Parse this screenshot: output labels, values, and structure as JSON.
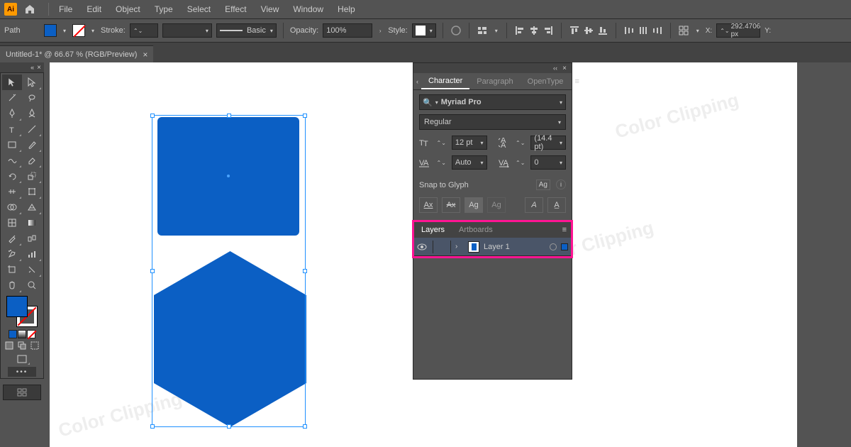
{
  "menu": {
    "items": [
      "File",
      "Edit",
      "Object",
      "Type",
      "Select",
      "Effect",
      "View",
      "Window",
      "Help"
    ]
  },
  "control": {
    "mode_label": "Path",
    "stroke_label": "Stroke:",
    "stroke_weight": "",
    "stroke_profile": "Basic",
    "opacity_label": "Opacity:",
    "opacity_value": "100%",
    "style_label": "Style:",
    "x_label": "X:",
    "x_value": "292.4706 px",
    "y_label": "Y:"
  },
  "tab": {
    "title": "Untitled-1* @ 66.67 % (RGB/Preview)",
    "close": "×"
  },
  "colors": {
    "accent": "#0b5fc4",
    "highlight": "#ff1493"
  },
  "watermark": "Color Clipping",
  "char_panel": {
    "tabs": [
      "Character",
      "Paragraph",
      "OpenType"
    ],
    "font_family": "Myriad Pro",
    "font_style": "Regular",
    "size": "12 pt",
    "leading": "(14.4 pt)",
    "kerning": "Auto",
    "tracking": "0",
    "snap_label": "Snap to Glyph"
  },
  "layers_panel": {
    "tabs": [
      "Layers",
      "Artboards"
    ],
    "layer_name": "Layer 1"
  }
}
